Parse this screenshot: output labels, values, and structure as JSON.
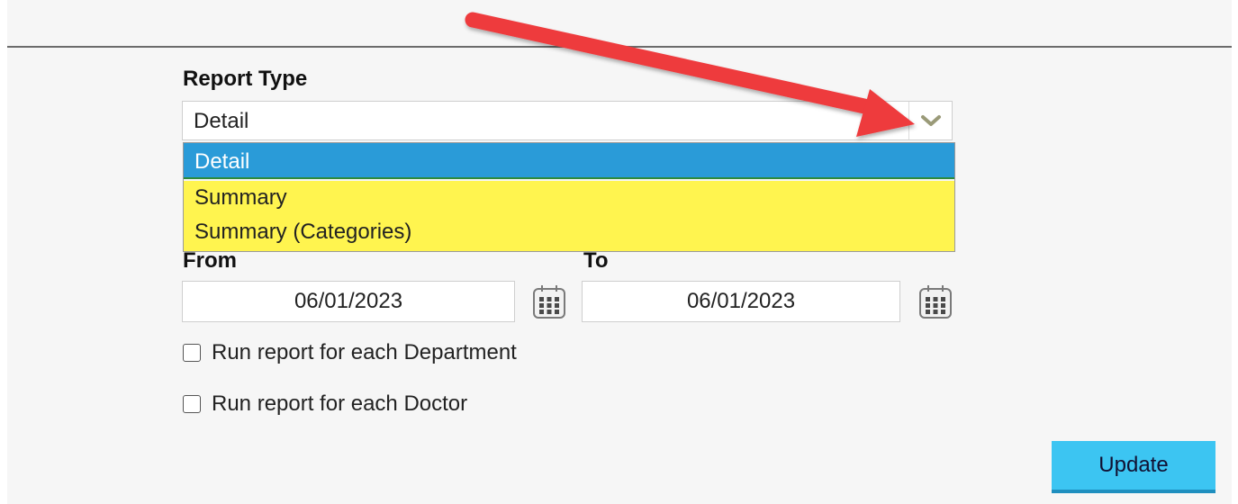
{
  "report_type": {
    "label": "Report Type",
    "selected": "Detail",
    "options": [
      "Detail",
      "Summary",
      "Summary (Categories)"
    ]
  },
  "date_range": {
    "from_label": "From",
    "from_value": "06/01/2023",
    "to_label": "To",
    "to_value": "06/01/2023"
  },
  "options": {
    "each_department": "Run report for each Department",
    "each_doctor": "Run report for each Doctor"
  },
  "actions": {
    "update_label": "Update"
  },
  "colors": {
    "selected_option": "#2a9bd8",
    "highlight": "#fff44f",
    "button": "#3cc5f2",
    "annotation_arrow": "#ee3a3e"
  },
  "icons": {
    "dropdown": "chevron-down-icon",
    "calendar": "calendar-icon",
    "annotation": "red-arrow-annotation"
  }
}
